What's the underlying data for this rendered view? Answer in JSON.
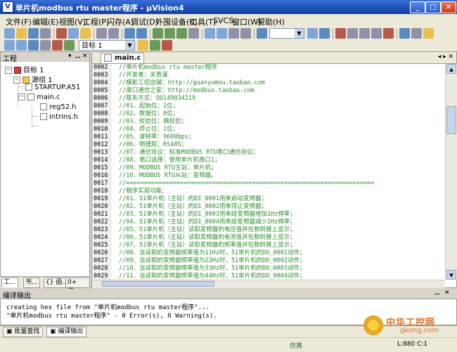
{
  "window": {
    "title": "单片机modbus rtu master程序 - µVision4",
    "app_icon": "V"
  },
  "menu": [
    "文件(F)",
    "编辑(E)",
    "视图(V)",
    "工程(P)",
    "闪存(A)",
    "调试(D)",
    "外围设备(K)",
    "工具(T)",
    "SVCS",
    "窗口(W)",
    "帮助(H)"
  ],
  "toolbar": {
    "target_label": "目标 1"
  },
  "project_panel": {
    "title": "工程",
    "tree": [
      {
        "label": "目标 1"
      },
      {
        "label": "源组 1"
      },
      {
        "label": "STARTUP.A51"
      },
      {
        "label": "main.c"
      },
      {
        "label": "reg52.h"
      },
      {
        "label": "intrins.h"
      }
    ],
    "tabs": [
      "工...",
      "书...",
      "{} 函...",
      "0+ 模..."
    ]
  },
  "editor": {
    "tab": "main.c",
    "lines": [
      {
        "n": "0002",
        "t": "//单片机modbus rtu master程序"
      },
      {
        "n": "0003",
        "t": "//开发者：关育谋"
      },
      {
        "n": "0004",
        "t": "//模影工控店铺：http://guanyumou.taobao.com"
      },
      {
        "n": "0005",
        "t": "//串口通信之家：http://modbus.taobao.com"
      },
      {
        "n": "0006",
        "t": "//联系方式：QQ149034219"
      },
      {
        "n": "0007",
        "t": "//01、起始位：1位；"
      },
      {
        "n": "0008",
        "t": "//02、数据位：8位；"
      },
      {
        "n": "0009",
        "t": "//03、校验位：偶校验；"
      },
      {
        "n": "0010",
        "t": "//04、停止位：1位；"
      },
      {
        "n": "0011",
        "t": "//05、波特率：9600bps；"
      },
      {
        "n": "0012",
        "t": "//06、物理层：RS485；"
      },
      {
        "n": "0013",
        "t": "//07、通信协议：标准MODBUS RTU串口通信协议；"
      },
      {
        "n": "0014",
        "t": "//08、串口选择：使用单片机串口1；"
      },
      {
        "n": "0015",
        "t": "//09、MODBUS RTU主站：单片机；"
      },
      {
        "n": "0016",
        "t": "//10、MODBUS RTU从站：变频器。"
      },
      {
        "n": "0017",
        "t": "//====================================================================="
      },
      {
        "n": "0018",
        "t": "//程序实现功能："
      },
      {
        "n": "0019",
        "t": "//01、51单片机（主站）的DI_0001用来启动变频器；"
      },
      {
        "n": "0020",
        "t": "//02、51单片机（主站）的DI_0002用来停止变频器；"
      },
      {
        "n": "0021",
        "t": "//03、51单片机（主站）的DI_0003用来给变频器增加1Hz频率；"
      },
      {
        "n": "0022",
        "t": "//04、51单片机（主站）的DI_0004用来给变频器减少1Hz频率；"
      },
      {
        "n": "0023",
        "t": "//05、51单片机（主站）读取变频器的电压值并在数码管上显示；"
      },
      {
        "n": "0024",
        "t": "//06、51单片机（主站）读取变频器的电流值并在数码管上显示；"
      },
      {
        "n": "0025",
        "t": "//07、51单片机（主站）读取变频器的频率值并在数码管上显示；"
      },
      {
        "n": "0026",
        "t": "//08、当读取的变频器频率值为11Hz时，51单片机的DO_0001动作；"
      },
      {
        "n": "0027",
        "t": "//09、当读取的变频器频率值为22Hz时，51单片机的DO_0002动作；"
      },
      {
        "n": "0028",
        "t": "//10、当读取的变频器频率值为33Hz时，51单片机的DO_0003动作；"
      },
      {
        "n": "0029",
        "t": "//11、当读取的变频器频率值为44Hz时，51单片机的DO_0004动作；"
      }
    ]
  },
  "output": {
    "title": "编译输出",
    "lines": [
      "creating hex file from \"单片机modbus rtu master程序\"...",
      "\"单片机modbus rtu master程序\" - 0 Error(s), 0 Warning(s)."
    ],
    "tabs": [
      "批量查找",
      "编译输出"
    ]
  },
  "status": {
    "mode": "仿真",
    "position": "L:880 C:1"
  },
  "watermark": {
    "cn": "中华工控网",
    "en": "gkong.com"
  }
}
